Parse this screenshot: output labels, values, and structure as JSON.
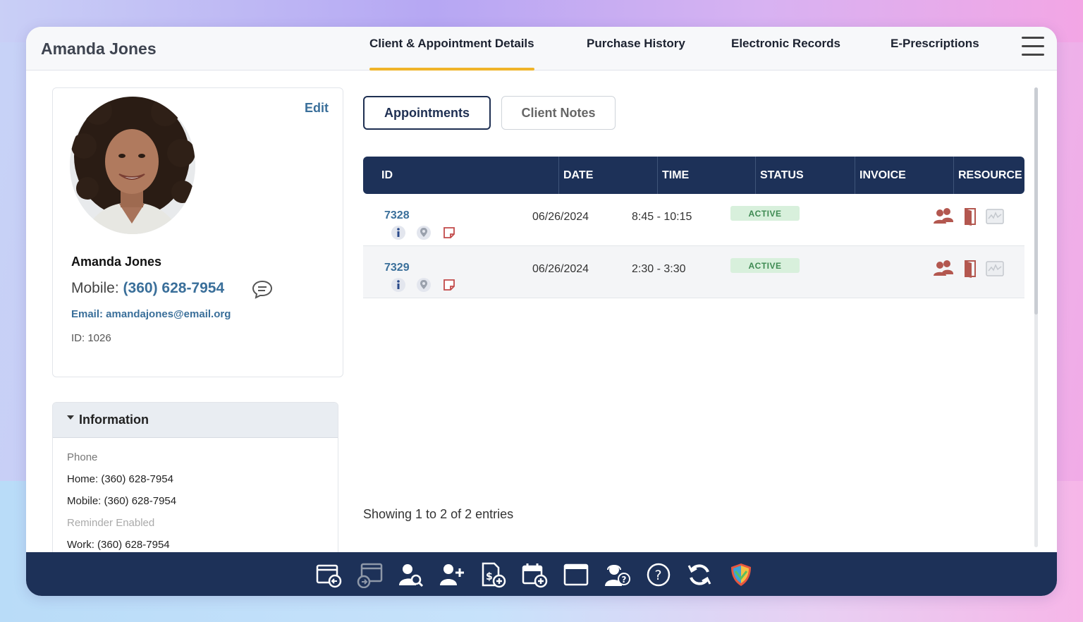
{
  "header": {
    "client_name": "Amanda Jones",
    "tabs": [
      {
        "label": "Client & Appointment Details",
        "active": true
      },
      {
        "label": "Purchase History",
        "active": false
      },
      {
        "label": "Electronic Records",
        "active": false
      },
      {
        "label": "E-Prescriptions",
        "active": false
      }
    ],
    "accent_color": "#f0b429"
  },
  "client_card": {
    "edit_label": "Edit",
    "name": "Amanda Jones",
    "mobile_label": "Mobile:",
    "mobile_number": "(360) 628-7954",
    "email": "Email: amandajones@email.org",
    "id_text": "ID: 1026"
  },
  "information": {
    "title": "Information",
    "lines": [
      "Phone",
      "Home: (360) 628-7954",
      "Mobile: (360) 628-7954",
      "Reminder Enabled",
      "Work: (360) 628-7954"
    ]
  },
  "subtabs": {
    "appointments": "Appointments",
    "client_notes": "Client Notes"
  },
  "appointments_table": {
    "columns": [
      "ID",
      "DATE",
      "TIME",
      "STATUS",
      "INVOICE",
      "RESOURCE"
    ],
    "rows": [
      {
        "id": "7328",
        "date": "06/26/2024",
        "time": "8:45 - 10:15",
        "status": "ACTIVE",
        "invoice": ""
      },
      {
        "id": "7329",
        "date": "06/26/2024",
        "time": "2:30 - 3:30",
        "status": "ACTIVE",
        "invoice": ""
      }
    ],
    "header_color": "#1d3158",
    "status_color": "#3e8a52"
  },
  "entries_text": "Showing 1 to 2 of 2 entries",
  "toolbar": {
    "icons": [
      "checkout-icon",
      "transfer-icon",
      "search-client-icon",
      "add-client-icon",
      "add-invoice-icon",
      "add-appointment-icon",
      "window-icon",
      "support-icon",
      "help-icon",
      "refresh-icon",
      "shield-icon"
    ]
  }
}
